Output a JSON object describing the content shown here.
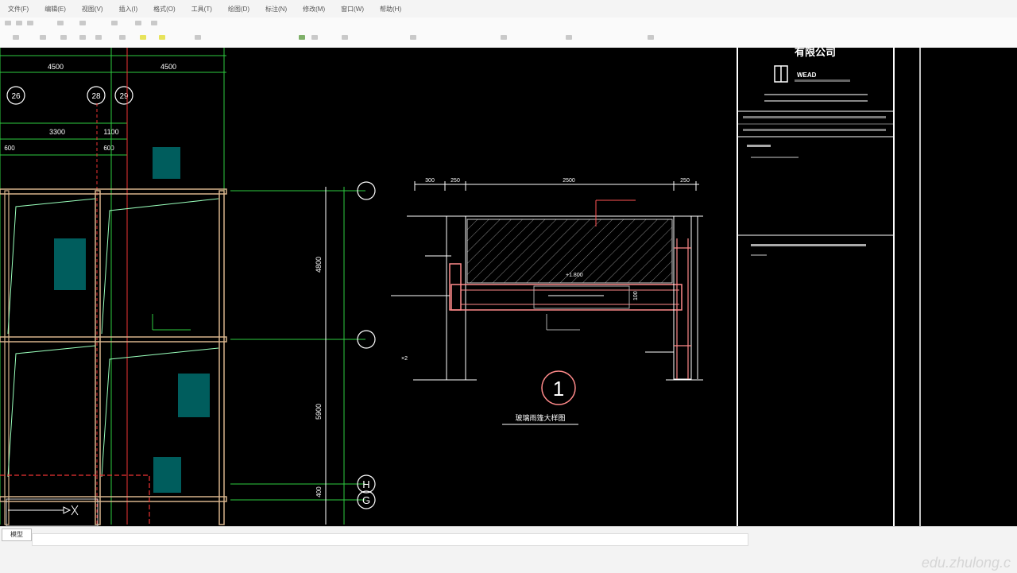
{
  "app": {
    "menus": [
      "文件(F)",
      "编辑(E)",
      "视图(V)",
      "插入(I)",
      "格式(O)",
      "工具(T)",
      "绘图(D)",
      "标注(N)",
      "修改(M)",
      "窗口(W)",
      "帮助(H)"
    ]
  },
  "drawing": {
    "dims_top": [
      "4500",
      "4500"
    ],
    "axis_top": [
      "26",
      "28",
      "29"
    ],
    "dims_second": [
      "3300",
      "1100"
    ],
    "dims_small": [
      "600",
      "600"
    ],
    "dim_right_1": "4800",
    "dim_right_2": "5900",
    "dim_right_3": "400",
    "axis_right": [
      "H",
      "G"
    ],
    "detail_dims": [
      "300",
      "250",
      "2500",
      "250"
    ],
    "detail_number": "1",
    "detail_caption": "玻璃雨篷大样图",
    "elev_label": "+1.800",
    "slab_label": "100",
    "x2": "×2"
  },
  "title_block": {
    "company_cn": "有限公司",
    "logo_text": "WEAD"
  },
  "cmd": {
    "model_tab": "模型"
  },
  "watermark": "edu.zhulong.c"
}
